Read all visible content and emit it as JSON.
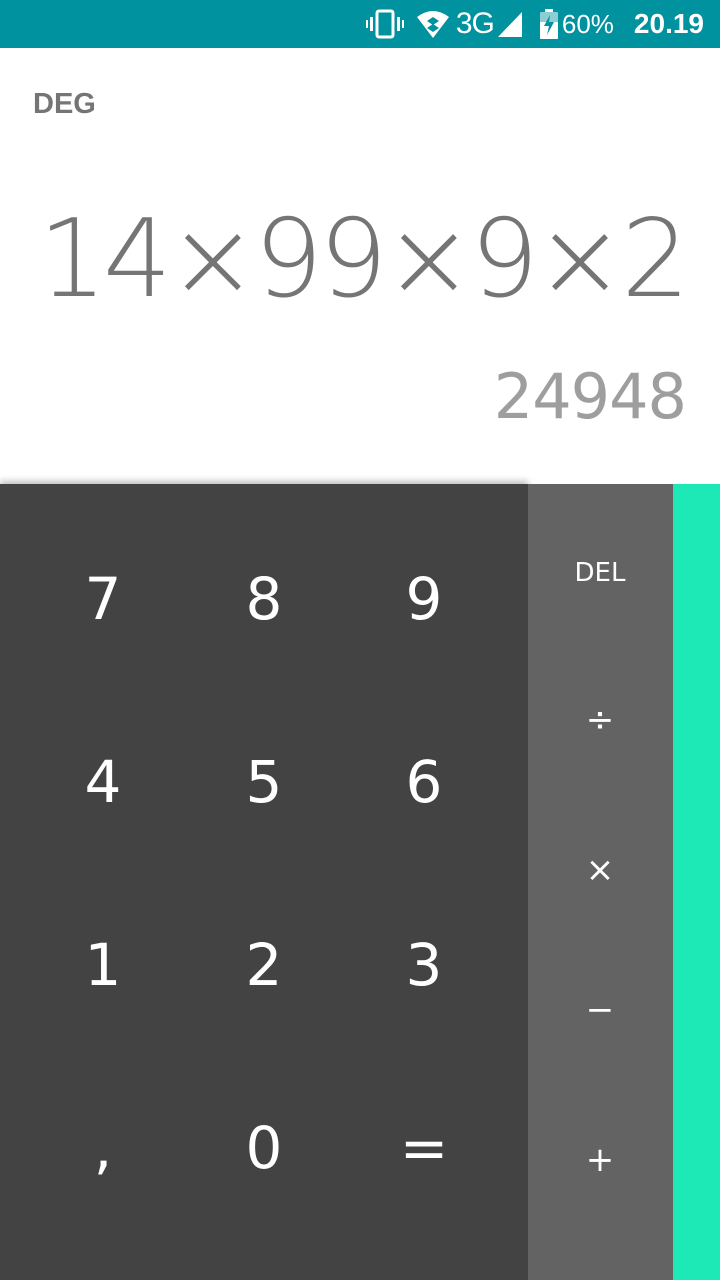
{
  "status_bar": {
    "network": "3G",
    "battery_percent": "60%",
    "time": "20.19",
    "icons": [
      "vibrate-icon",
      "wifi-icon",
      "signal-icon",
      "battery-charging-icon"
    ]
  },
  "display": {
    "mode": "DEG",
    "expression": "14×99×9×2",
    "result": "24948"
  },
  "keypad": {
    "digits": {
      "k7": "7",
      "k8": "8",
      "k9": "9",
      "k4": "4",
      "k5": "5",
      "k6": "6",
      "k1": "1",
      "k2": "2",
      "k3": "3",
      "decimal": ",",
      "k0": "0",
      "equals": "="
    },
    "operators": {
      "del": "DEL",
      "divide": "÷",
      "multiply": "×",
      "minus": "−",
      "plus": "+"
    }
  },
  "colors": {
    "status_bar": "#00929e",
    "numeric_pad": "#434343",
    "operator_pad": "#636363",
    "advanced_panel": "#1de9b6",
    "display_text": "#757575",
    "result_text": "#9e9e9e"
  }
}
